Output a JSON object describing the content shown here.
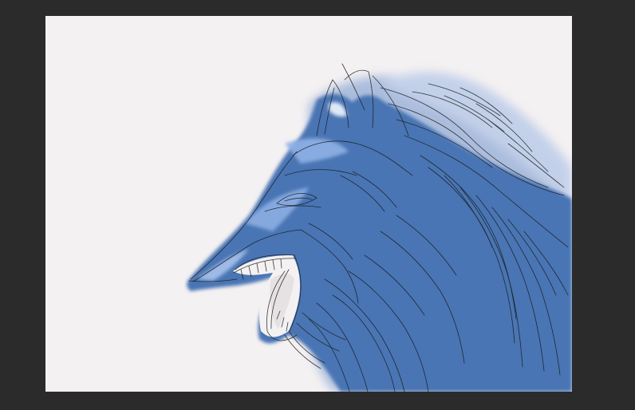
{
  "app": {
    "workspace_bg": "#2b2b2b"
  },
  "canvas": {
    "paper_color": "#f4f1f2",
    "artwork": {
      "subject": "wolf-head-growling-sketch",
      "fill_color": "#4a74b4",
      "highlight_color": "#8fb1e6",
      "line_color": "#1a1a1a"
    }
  }
}
